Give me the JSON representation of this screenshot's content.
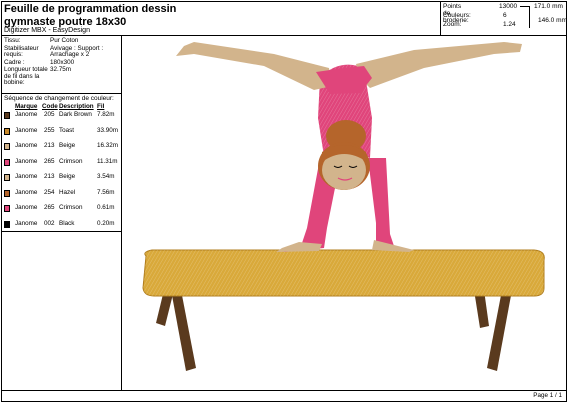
{
  "header": {
    "title_line1": "Feuille de programmation dessin",
    "title_line2": "gymnaste poutre 18x30",
    "software": "Digitizer MBX - EasyDesign"
  },
  "stats": {
    "stitches_label": "Points de broderie:",
    "stitches_value": "13000",
    "colors_label": "Couleurs:",
    "colors_value": "6",
    "zoom_label": "Zoom:",
    "zoom_value": "1.24",
    "width_mm": "171.0 mm",
    "height_mm": "146.0 mm"
  },
  "info": [
    {
      "key": "Tissu:",
      "value": "Pur Coton"
    },
    {
      "key": "Stabilisateur requis:",
      "value": "Avivage : Support : Arrachage x 2"
    },
    {
      "key": "Cadre :",
      "value": "180x300"
    },
    {
      "key": "Longueur totale de fil dans la bobine:",
      "value": "32.75m"
    }
  ],
  "sequence": {
    "title": "Séquence de changement de couleur:",
    "headers": {
      "brand": "Marque",
      "code": "Code",
      "description": "Description",
      "thread": "Fil"
    },
    "rows": [
      {
        "brand": "Janome",
        "code": "205",
        "description": "Dark Brown",
        "thread": "7.82m",
        "color": "#5a3a1e"
      },
      {
        "brand": "Janome",
        "code": "255",
        "description": "Toast",
        "thread": "33.90m",
        "color": "#c98a2a"
      },
      {
        "brand": "Janome",
        "code": "213",
        "description": "Beige",
        "thread": "16.32m",
        "color": "#d2b48c"
      },
      {
        "brand": "Janome",
        "code": "265",
        "description": "Crimson",
        "thread": "11.31m",
        "color": "#e0457b"
      },
      {
        "brand": "Janome",
        "code": "213",
        "description": "Beige",
        "thread": "3.54m",
        "color": "#d2b48c"
      },
      {
        "brand": "Janome",
        "code": "254",
        "description": "Hazel",
        "thread": "7.56m",
        "color": "#b5652b"
      },
      {
        "brand": "Janome",
        "code": "265",
        "description": "Crimson",
        "thread": "0.61m",
        "color": "#e0457b"
      },
      {
        "brand": "Janome",
        "code": "002",
        "description": "Black",
        "thread": "0.20m",
        "color": "#000000"
      }
    ]
  },
  "footer": {
    "page": "Page 1 / 1"
  }
}
